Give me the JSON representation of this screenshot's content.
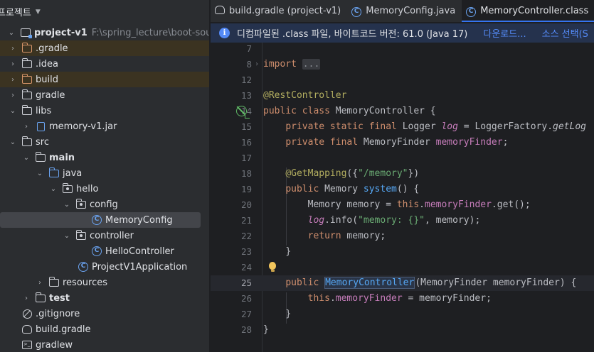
{
  "project_panel": {
    "title": "프로젝트",
    "tree": [
      {
        "label": "project-v1",
        "path": "F:\\spring_lecture\\boot-source-",
        "icon": "module-icon",
        "expanded": true
      },
      {
        "label": ".gradle",
        "icon": "folder-excluded-icon",
        "expanded": false
      },
      {
        "label": ".idea",
        "icon": "folder-icon",
        "expanded": false
      },
      {
        "label": "build",
        "icon": "folder-excluded-icon",
        "expanded": false
      },
      {
        "label": "gradle",
        "icon": "folder-icon",
        "expanded": false
      },
      {
        "label": "libs",
        "icon": "folder-icon",
        "expanded": true
      },
      {
        "label": "memory-v1.jar",
        "icon": "jar-icon",
        "expanded": false
      },
      {
        "label": "src",
        "icon": "folder-icon",
        "expanded": true
      },
      {
        "label": "main",
        "icon": "source-root-icon",
        "expanded": true
      },
      {
        "label": "java",
        "icon": "source-folder-icon",
        "expanded": true
      },
      {
        "label": "hello",
        "icon": "package-icon",
        "expanded": true
      },
      {
        "label": "config",
        "icon": "package-icon",
        "expanded": true
      },
      {
        "label": "MemoryConfig",
        "icon": "class-icon"
      },
      {
        "label": "controller",
        "icon": "package-icon",
        "expanded": true
      },
      {
        "label": "HelloController",
        "icon": "class-icon"
      },
      {
        "label": "ProjectV1Application",
        "icon": "spring-class-icon"
      },
      {
        "label": "resources",
        "icon": "resources-folder-icon",
        "expanded": false
      },
      {
        "label": "test",
        "icon": "folder-icon",
        "expanded": false
      },
      {
        "label": ".gitignore",
        "icon": "gitignore-icon"
      },
      {
        "label": "build.gradle",
        "icon": "gradle-icon"
      },
      {
        "label": "gradlew",
        "icon": "terminal-file-icon"
      }
    ]
  },
  "tabs": [
    {
      "label": "build.gradle (project-v1)",
      "icon": "gradle-icon",
      "active": false
    },
    {
      "label": "MemoryConfig.java",
      "icon": "class-icon",
      "active": false
    },
    {
      "label": "MemoryController.class",
      "icon": "class-icon",
      "active": true,
      "close": "×"
    }
  ],
  "banner": {
    "info_glyph": "i",
    "text": "디컴파일된 .class 파일, 바이트코드 버전: 61.0 (Java 17)",
    "download_label": "다운로드...",
    "choose_source_label": "소스 선택(S"
  },
  "editor": {
    "current_line": "25",
    "lines": [
      {
        "n": "7",
        "text": ""
      },
      {
        "n": "8",
        "text": "import ..."
      },
      {
        "n": "12",
        "text": ""
      },
      {
        "n": "13",
        "text": "@RestController"
      },
      {
        "n": "14",
        "text": "public class MemoryController {"
      },
      {
        "n": "15",
        "text": "    private static final Logger log = LoggerFactory.getLog"
      },
      {
        "n": "16",
        "text": "    private final MemoryFinder memoryFinder;"
      },
      {
        "n": "17",
        "text": ""
      },
      {
        "n": "18",
        "text": "    @GetMapping({\"/memory\"})"
      },
      {
        "n": "19",
        "text": "    public Memory system() {"
      },
      {
        "n": "20",
        "text": "        Memory memory = this.memoryFinder.get();"
      },
      {
        "n": "21",
        "text": "        log.info(\"memory: {}\", memory);"
      },
      {
        "n": "22",
        "text": "        return memory;"
      },
      {
        "n": "23",
        "text": "    }"
      },
      {
        "n": "24",
        "text": ""
      },
      {
        "n": "25",
        "text": "    public MemoryController(MemoryFinder memoryFinder) {"
      },
      {
        "n": "26",
        "text": "        this.memoryFinder = memoryFinder;"
      },
      {
        "n": "27",
        "text": "    }"
      },
      {
        "n": "28",
        "text": "}"
      }
    ],
    "tokens": {
      "l8": {
        "kw": "import",
        "fold": "..."
      },
      "l13": {
        "ann": "@RestController"
      },
      "l14": {
        "kw": "public class",
        "name": "MemoryController {"
      },
      "l15": {
        "kw": "private static final",
        "type": "Logger",
        "field": "log",
        "eq": "=",
        "rhs": "LoggerFactory.",
        "call": "getLog"
      },
      "l16": {
        "kw": "private final",
        "type": "MemoryFinder",
        "field": "memoryFinder",
        "end": ";"
      },
      "l18": {
        "ann": "@GetMapping",
        "open": "({",
        "str": "\"/memory\"",
        "close": "})"
      },
      "l19": {
        "kw": "public",
        "type": "Memory",
        "method": "system",
        "rest": "() {"
      },
      "l20": {
        "decl": "Memory memory = ",
        "kw": "this",
        "dot": ".",
        "field": "memoryFinder",
        "rest": ".get();"
      },
      "l21": {
        "field": "log",
        "call": ".info(",
        "str": "\"memory: {}\"",
        "rest": ", memory);"
      },
      "l22": {
        "kw": "return",
        "rest": " memory;"
      },
      "l23": {
        "text": "}"
      },
      "l25": {
        "kw": "public",
        "name": "MemoryController",
        "rest": "(MemoryFinder memoryFinder) {"
      },
      "l26": {
        "kw": "this",
        "dot": ".",
        "field": "memoryFinder",
        "rest": " = memoryFinder;"
      },
      "l27": {
        "text": "}"
      },
      "l28": {
        "text": "}"
      }
    }
  },
  "colors": {
    "keyword": "#cf8e6d",
    "annotation": "#b3ae60",
    "field": "#c77dbb",
    "string": "#6aab73",
    "method": "#56a8f5",
    "accent": "#3574f0"
  }
}
